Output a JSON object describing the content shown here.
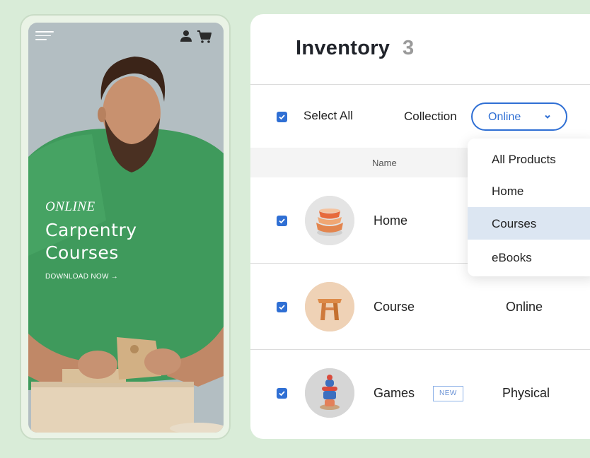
{
  "phone": {
    "icons": {
      "menu": "hamburger-icon",
      "user": "user-icon",
      "cart": "cart-icon"
    },
    "hero": {
      "eyebrow": "ONLINE",
      "title": "Carpentry Courses",
      "cta": "DOWNLOAD NOW →"
    }
  },
  "inventory": {
    "title": "Inventory",
    "count": "3",
    "select_all_label": "Select All",
    "collection_label": "Collection",
    "collection_value": "Online",
    "columns": {
      "name": "Name"
    },
    "dropdown": {
      "options": [
        "All Products",
        "Home",
        "Courses",
        "eBooks"
      ],
      "highlighted": "Courses"
    },
    "rows": [
      {
        "name": "Home",
        "type": "",
        "checked": true
      },
      {
        "name": "Course",
        "type": "Online",
        "checked": true
      },
      {
        "name": "Games",
        "badge": "NEW",
        "type": "Physical",
        "checked": true
      }
    ]
  },
  "colors": {
    "accent": "#2f6fd4",
    "background": "#d9ecd8",
    "shirt": "#3f9a5c"
  }
}
